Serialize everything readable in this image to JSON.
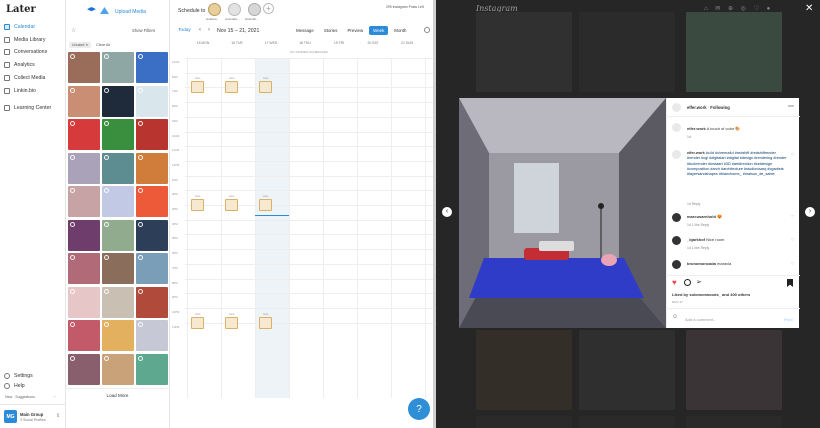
{
  "sidebar": {
    "logo": "Later",
    "items": [
      {
        "label": "Calendar"
      },
      {
        "label": "Media Library"
      },
      {
        "label": "Conversations"
      },
      {
        "label": "Analytics"
      },
      {
        "label": "Collect Media"
      },
      {
        "label": "Linkin.bio"
      },
      {
        "label": "Learning Center"
      }
    ],
    "bottom": {
      "settings": "Settings",
      "help": "Help",
      "new": "New",
      "suggestions": "Suggestions",
      "group": "Main Group",
      "profiles": "3 Social Profiles",
      "initials": "MG"
    }
  },
  "media": {
    "upload_label": "Upload Media",
    "show_filters": "Show Filters",
    "chip_unused": "Unused",
    "clear_all": "Clear All",
    "load_more": "Load More"
  },
  "calendar": {
    "schedule_to": "Schedule to",
    "posts_left": "299 Instagram Posts Left",
    "profile_labels": [
      "studiona...",
      "cotomabe...",
      "thefoodb..."
    ],
    "today": "Today",
    "range": "Nov 15 – 21, 2021",
    "views": [
      "Message",
      "Stories",
      "Preview",
      "Week",
      "Month"
    ],
    "active_view": "Week",
    "days": [
      "15 MON",
      "16 TUE",
      "17 WED",
      "18 THU",
      "19 FRI",
      "20 SAT",
      "21 SUN"
    ],
    "banner": "NO STORIES SCHEDULED",
    "times": [
      "12AM",
      "6AM",
      "7AM",
      "8AM",
      "9AM",
      "10AM",
      "11AM",
      "12PM",
      "1PM",
      "2PM",
      "3PM",
      "4PM",
      "5PM",
      "6PM",
      "7PM",
      "8PM",
      "9PM",
      "10PM",
      "11PM"
    ],
    "slot_label": "Auto"
  },
  "modal": {
    "brand": "Instagram",
    "username": "elfer.work",
    "following": "Following",
    "caption": "A touch of color 🎨",
    "caption_time": "1d",
    "hashtags_user": "elfer.work",
    "hashtags": "#c4d #cinema4d #redshift #redshiftrender #render #cgi #digitalart #digital #design #rendering #render #fuckrender #instaart #3D #artdirection #setdesign #composition #arch #architecture #studiovisarq #cgartists #layersandshapes #blanchome_ #maison_de_sable",
    "hashtags_meta": "1d   Reply",
    "comments": [
      {
        "user": "marcusarnhold",
        "text": "😍",
        "meta": "1d   1 like   Reply"
      },
      {
        "user": "_bjarkhof",
        "text": "Nice room",
        "meta": "1d   1 like   Reply"
      },
      {
        "user": "brunomoncada",
        "text": "maravla",
        "meta": ""
      }
    ],
    "liked_by": "Liked by solomonwoods_ and 400 others",
    "time_ago": "NOV 17",
    "add_comment": "Add a comment...",
    "post_label": "Post"
  },
  "colors": {
    "accent": "#2c8bd8",
    "overlay": "#262626",
    "chat": "#2f8fd6"
  }
}
